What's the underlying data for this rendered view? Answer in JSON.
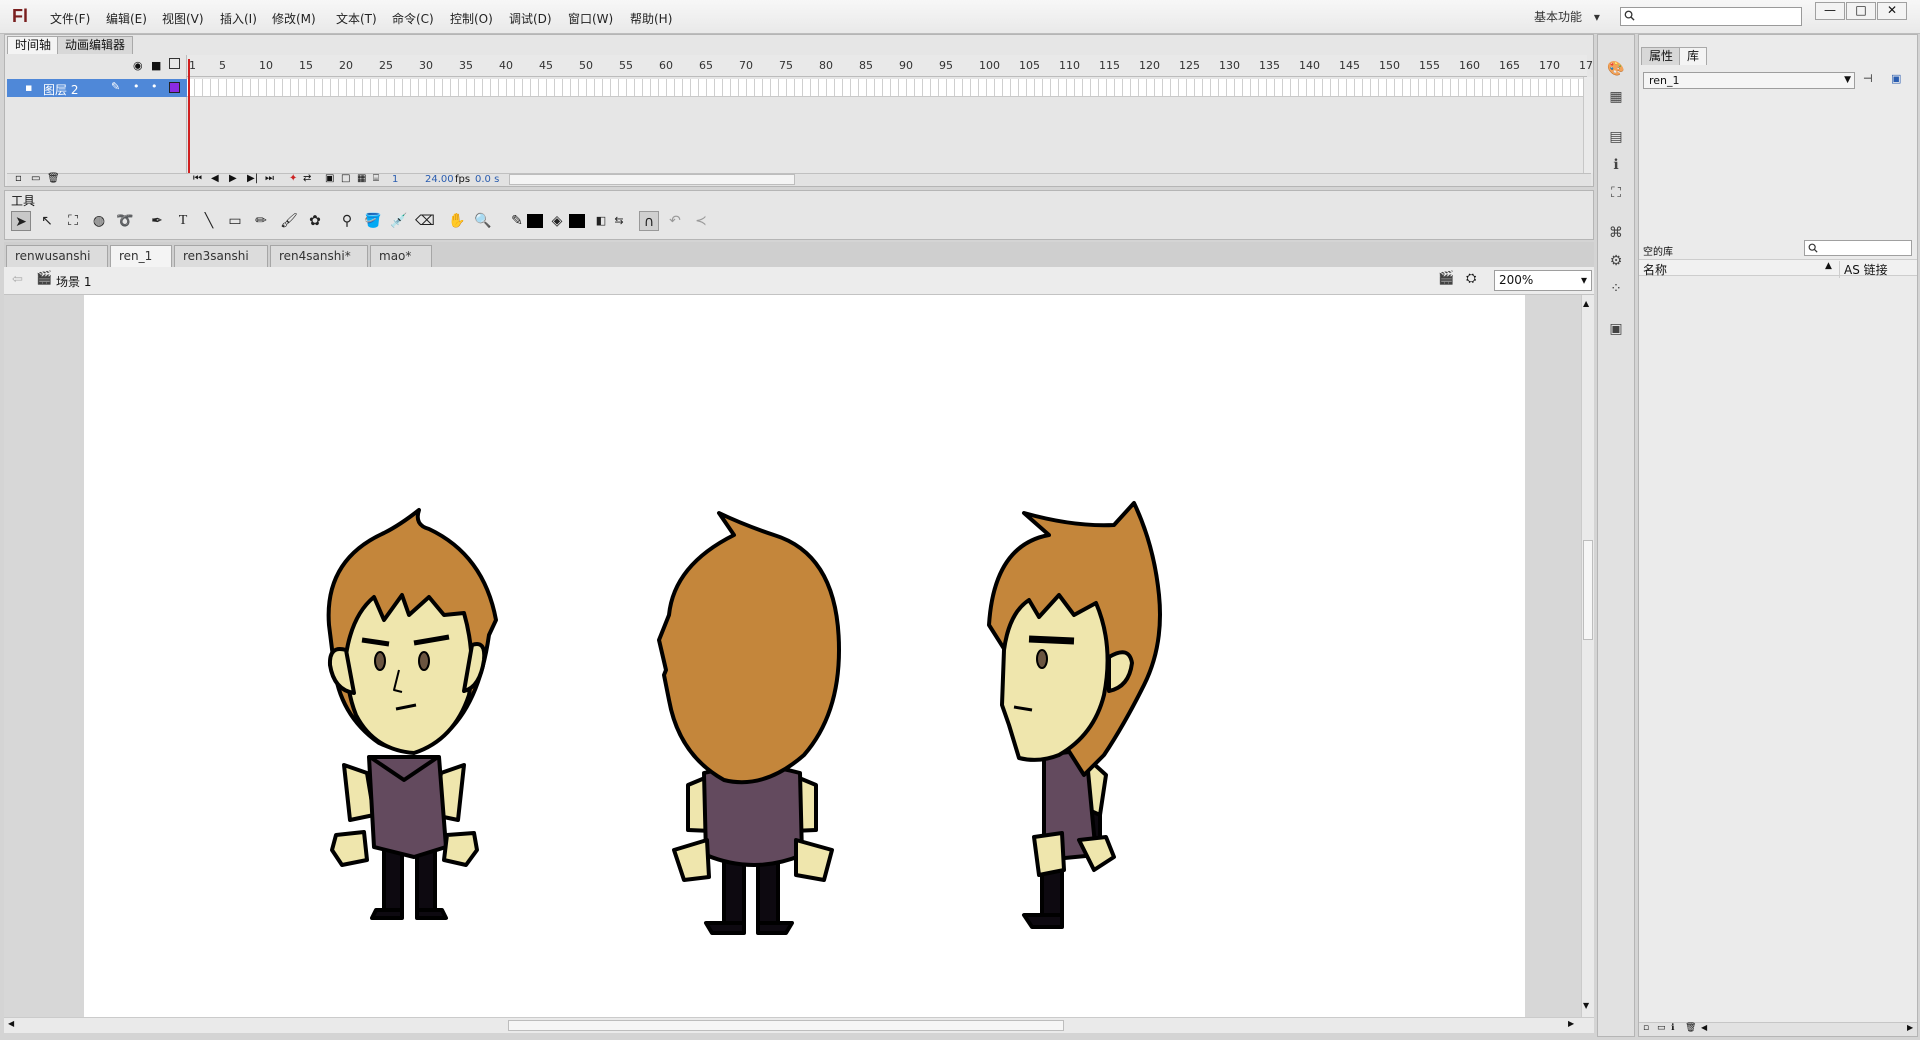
{
  "app": {
    "logo": "Fl",
    "workspace": "基本功能",
    "workspace_arrow": "▾"
  },
  "menu": [
    "文件(F)",
    "编辑(E)",
    "视图(V)",
    "插入(I)",
    "修改(M)",
    "文本(T)",
    "命令(C)",
    "控制(O)",
    "调试(D)",
    "窗口(W)",
    "帮助(H)"
  ],
  "window_controls": {
    "minimize": "—",
    "maximize": "□",
    "close": "✕"
  },
  "timeline": {
    "tabs": [
      "时间轴",
      "动画编辑器"
    ],
    "layer_name": "图层 2",
    "ruler": [
      "1",
      "5",
      "10",
      "15",
      "20",
      "25",
      "30",
      "35",
      "40",
      "45",
      "50",
      "55",
      "60",
      "65",
      "70",
      "75",
      "80",
      "85",
      "90",
      "95",
      "100",
      "105",
      "110",
      "115",
      "120",
      "125",
      "130",
      "135",
      "140",
      "145",
      "150",
      "155",
      "160",
      "165",
      "170",
      "17"
    ],
    "current_frame": "1",
    "fps": "24.00",
    "fps_unit": "fps",
    "time": "0.0 s"
  },
  "tools": {
    "title": "工具"
  },
  "doc_tabs": [
    {
      "label": "renwusanshi",
      "close": "×"
    },
    {
      "label": "ren_1",
      "close": "×"
    },
    {
      "label": "ren3sanshi",
      "close": "×"
    },
    {
      "label": "ren4sanshi*",
      "close": "×"
    },
    {
      "label": "mao*",
      "close": "×"
    }
  ],
  "editbar": {
    "scene": "场景 1",
    "zoom": "200%"
  },
  "right_panel": {
    "tabs": [
      "属性",
      "库"
    ],
    "library_select": "ren_1",
    "empty_label": "空的库",
    "col_name": "名称",
    "col_linkage": "AS 链接"
  },
  "colors": {
    "hair": "#c4863b",
    "skin": "#efe6ad",
    "shirt": "#634a5e",
    "outline": "#000000",
    "selection": "#4f88d8"
  }
}
